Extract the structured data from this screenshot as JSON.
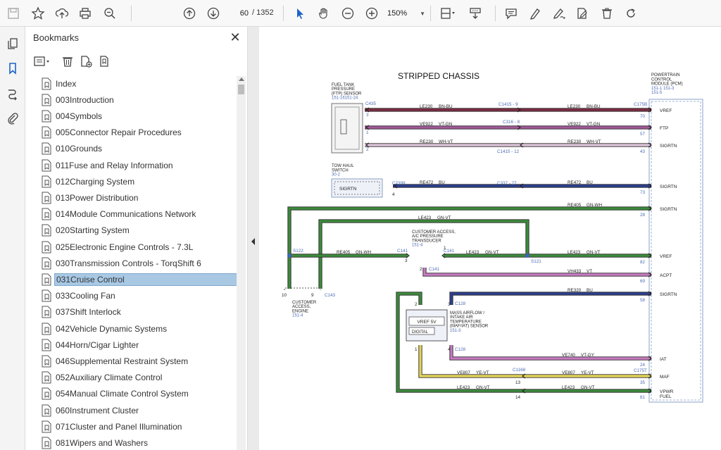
{
  "toolbar": {
    "page_current": "60",
    "page_total": "/ 1352",
    "zoom": "150%",
    "icons": [
      "save-icon",
      "star-icon",
      "upload-icon",
      "print-icon",
      "zoom-out-search-icon",
      "arrow-up-circle-icon",
      "arrow-down-circle-icon",
      "cursor-icon",
      "hand-icon",
      "minus-circle-icon",
      "plus-circle-icon",
      "page-fit-icon",
      "scroll-mode-icon",
      "comment-icon",
      "highlight-pen-icon",
      "sign-pen-icon",
      "edit-doc-icon",
      "trash-icon",
      "rotate-icon"
    ]
  },
  "bookmarks": {
    "title": "Bookmarks",
    "items": [
      "Index",
      "003Introduction",
      "004Symbols",
      "005Connector Repair Procedures",
      "010Grounds",
      "011Fuse and Relay Information",
      "012Charging System",
      "013Power Distribution",
      "014Module Communications Network",
      "020Starting System",
      "025Electronic Engine Controls - 7.3L",
      "030Transmission Controls - TorqShift 6",
      "031Cruise Control",
      "033Cooling Fan",
      "037Shift Interlock",
      "042Vehicle Dynamic Systems",
      "044Horn/Cigar Lighter",
      "046Supplemental Restraint System",
      "052Auxiliary Climate Control",
      "054Manual Climate Control System",
      "060Instrument Cluster",
      "071Cluster and Panel Illumination",
      "081Wipers and Washers"
    ],
    "selected_index": 12
  },
  "diagram": {
    "title": "STRIPPED CHASSIS",
    "pcm": [
      "POWERTRAIN",
      "CONTROL",
      "MODULE (PCM)",
      "151-1 151-3",
      "151-5"
    ],
    "ftp_sensor": [
      "FUEL TANK",
      "PRESSURE",
      "(FTP) SENSOR",
      "151-16151-24"
    ],
    "tow_haul": [
      "TOW HAUL",
      "SWITCH",
      "30-2"
    ],
    "tow_haul_pin": "SIGRTN",
    "ac_transducer": [
      "CUSTOMER ACCESS,",
      "A/C PRESSURE",
      "TRANSDUCER",
      "151-4"
    ],
    "customer_engine": [
      "CUSTOMER",
      "ACCESS,",
      "ENGINE",
      "151-4"
    ],
    "maf_sensor": [
      "MASS AIRFLOW /",
      "INTAKE AIR",
      "TEMPERATURE",
      "(MAF/IAT) SENSOR",
      "151-3"
    ],
    "maf_vref": "VREF 5V",
    "maf_digital": "DIGITAL",
    "pins": [
      "VREF",
      "FTP",
      "SIGRTN",
      "SIGRTN",
      "SIGRTN",
      "VREF",
      "ACPT",
      "SIGRTN",
      "IAT",
      "MAF",
      "VPWR"
    ],
    "pin_fuel": "FUEL",
    "pcm_pin_nums": [
      "70",
      "57",
      "43",
      "73",
      "28",
      "82",
      "69",
      "58",
      "24",
      "35",
      "81"
    ],
    "wires": [
      {
        "id": "LE230",
        "c": "BN-BU"
      },
      {
        "id": "VE922",
        "c": "VT-GN"
      },
      {
        "id": "RE230",
        "c": "WH-VT"
      },
      {
        "id": "RE472",
        "c": "BU"
      },
      {
        "id": "RE405",
        "c": "GN-WH"
      },
      {
        "id": "LE423",
        "c": "GN-VT"
      },
      {
        "id": "VH433",
        "c": "VT"
      },
      {
        "id": "RE320",
        "c": "BU"
      },
      {
        "id": "VE740",
        "c": "VT-GY"
      },
      {
        "id": "VE807",
        "c": "YE-VT"
      }
    ],
    "connectors": {
      "c435": "C435",
      "c1415_9": "C1415 - 9",
      "c175b": "C175B",
      "c316_8": "C316 - 8",
      "c1415_12": "C1415 - 12",
      "c2399": "C2399",
      "c337_27": "C337 - 27",
      "s122": "S122",
      "c141": "C141",
      "s121": "S121",
      "c143": "C143",
      "c128": "C128",
      "c1168": "C1168",
      "c175t": "C175T"
    },
    "pin_nums": {
      "n3": "3",
      "n1": "1",
      "n2": "2",
      "n4": "4",
      "n10": "10",
      "n9": "9",
      "n13": "13",
      "n14": "14"
    },
    "colors": {
      "brown": "#7b2d42",
      "violet": "#a05a96",
      "white": "#dcc3d8",
      "blue": "#2d3f8c",
      "green": "#3c8a3c",
      "pink": "#c57bbf",
      "yellow": "#e3d45a",
      "label": "#4b6ab3"
    }
  }
}
